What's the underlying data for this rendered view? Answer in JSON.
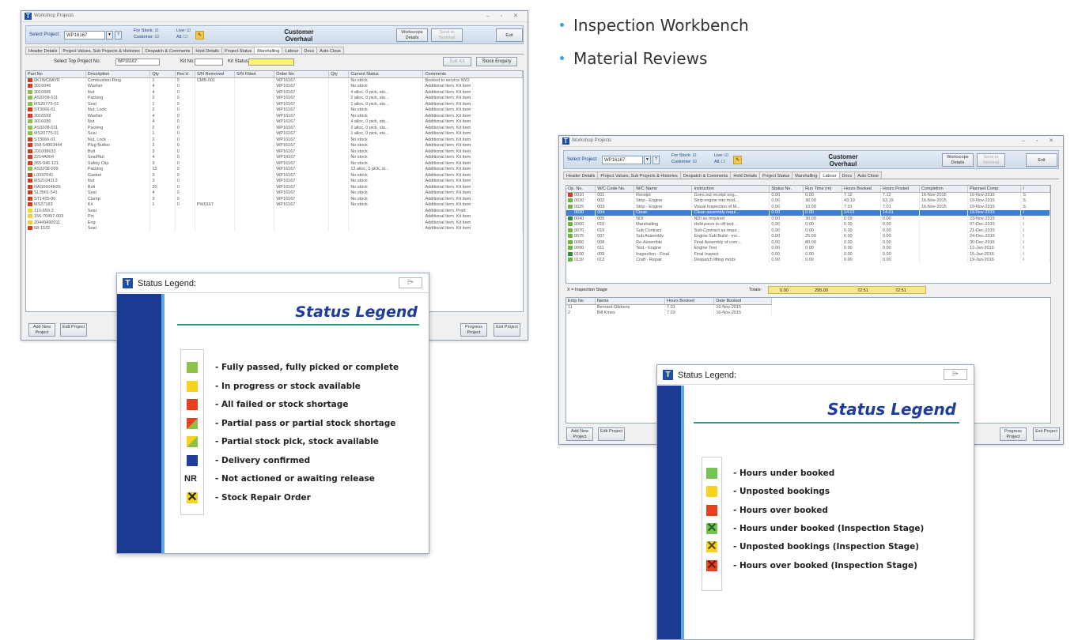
{
  "bullets": [
    "Inspection Workbench",
    "Material Reviews"
  ],
  "left_window": {
    "title": "Workshop Projects",
    "select_label": "Select Project:",
    "project": "WP16167",
    "checks": [
      "For Stock:",
      "Customer:",
      "Live:",
      "All:"
    ],
    "customer": "Customer Overhaul",
    "buttons": [
      "Workscope Details",
      "Send to Nominal",
      "Exit"
    ],
    "tabs": [
      "Header Details",
      "Project Values, Sub Projects & Histories",
      "Despatch & Comments",
      "Hold Details",
      "Project Status",
      "Marshalling",
      "Labour",
      "Docs",
      "Auto Close"
    ],
    "active_tab": "Marshalling",
    "sub_labels": [
      "Select Top Project No:",
      "Kit No:",
      "Kit Status:"
    ],
    "sub_value": "WP16167",
    "sub_buttons": [
      "Edit Kit",
      "Stock Enquiry"
    ],
    "columns": [
      "Part No",
      "Description",
      "Qty",
      "Rec'd",
      "S/N Removed",
      "S/N Fitted",
      "Order No",
      "Qty",
      "Current Status",
      "Comments"
    ],
    "rows": [
      {
        "c": "#d83a20",
        "v": [
          "0K1WC8AYR",
          "Combustion Ring",
          "1",
          "0",
          "CMB-001",
          "",
          "WP16167",
          "",
          "No stock",
          "Booked to service W/O"
        ]
      },
      {
        "c": "#d83a20",
        "v": [
          "3016046",
          "Washer",
          "4",
          "0",
          "",
          "",
          "WP16167",
          "",
          "No stock",
          "Additional Item. Kit item"
        ]
      },
      {
        "c": "#8bc34a",
        "v": [
          "3016686",
          "Nut",
          "4",
          "0",
          "",
          "",
          "WP16167",
          "",
          "4 alloc, 0 pick, sto...",
          "Additional Item. Kit item"
        ]
      },
      {
        "c": "#8bc34a",
        "v": [
          "AS3208-011",
          "Packing",
          "2",
          "0",
          "",
          "",
          "WP16167",
          "",
          "2 alloc, 0 pick, sto...",
          "Additional Item. Kit item"
        ]
      },
      {
        "c": "#8bc34a",
        "v": [
          "MS20775-01",
          "Seal",
          "1",
          "0",
          "",
          "",
          "WP16167",
          "",
          "1 alloc, 0 pick, sto...",
          "Additional Item. Kit item"
        ]
      },
      {
        "c": "#d83a20",
        "v": [
          "ST3066-01",
          "Nut, Lock",
          "2",
          "0",
          "",
          "",
          "WP16167",
          "",
          "No stock",
          "Additional Item. Kit item"
        ]
      },
      {
        "c": "#d83a20",
        "v": [
          "3016598",
          "Washer",
          "4",
          "0",
          "",
          "",
          "WP16167",
          "",
          "No stock",
          "Additional Item. Kit item"
        ]
      },
      {
        "c": "#8bc34a",
        "v": [
          "3016686",
          "Nut",
          "4",
          "0",
          "",
          "",
          "WP16167",
          "",
          "4 alloc, 0 pick, sto...",
          "Additional Item. Kit item"
        ]
      },
      {
        "c": "#8bc34a",
        "v": [
          "AS3208-011",
          "Packing",
          "2",
          "0",
          "",
          "",
          "WP16167",
          "",
          "2 alloc, 0 pick, sto...",
          "Additional Item. Kit item"
        ]
      },
      {
        "c": "#8bc34a",
        "v": [
          "MS20775-01",
          "Seal",
          "1",
          "0",
          "",
          "",
          "WP16167",
          "",
          "1 alloc, 0 pick, sto...",
          "Additional Item. Kit item"
        ]
      },
      {
        "c": "#d83a20",
        "v": [
          "ST3066-01",
          "Nut, Lock",
          "2",
          "0",
          "",
          "",
          "WP16167",
          "",
          "No stock",
          "Additional Item. Kit item"
        ]
      },
      {
        "c": "#d83a20",
        "v": [
          "158-54803444",
          "Plug Button",
          "3",
          "0",
          "",
          "",
          "WP16167",
          "",
          "No stock",
          "Additional Item. Kit item"
        ]
      },
      {
        "c": "#d83a20",
        "v": [
          "201008633",
          "Bolt",
          "3",
          "0",
          "",
          "",
          "WP16167",
          "",
          "No stock",
          "Additional Item. Kit item"
        ]
      },
      {
        "c": "#d83a20",
        "v": [
          "2214A004",
          "Seal/Nut",
          "4",
          "0",
          "",
          "",
          "WP16167",
          "",
          "No stock",
          "Additional Item. Kit item"
        ]
      },
      {
        "c": "#d83a20",
        "v": [
          "355-946-121",
          "Safety Clip",
          "3",
          "0",
          "",
          "",
          "WP16167",
          "",
          "No stock",
          "Additional Item. Kit item"
        ]
      },
      {
        "c": "#8bc34a",
        "v": [
          "AS3208-009",
          "Packing",
          "13",
          "0",
          "",
          "",
          "WP16167",
          "",
          "13 alloc, 0 pick, st...",
          "Additional Item. Kit item"
        ]
      },
      {
        "c": "#d83a20",
        "v": [
          "L0337041",
          "Gasket",
          "3",
          "0",
          "",
          "",
          "WP16167",
          "",
          "No stock",
          "Additional Item. Kit item"
        ]
      },
      {
        "c": "#d83a20",
        "v": [
          "MS21042L3",
          "Nut",
          "3",
          "0",
          "",
          "",
          "WP16167",
          "",
          "No stock",
          "Additional Item. Kit item"
        ]
      },
      {
        "c": "#d83a20",
        "v": [
          "NAS6604H26",
          "Bolt",
          "20",
          "0",
          "",
          "",
          "WP16167",
          "",
          "No stock",
          "Additional Item. Kit item"
        ]
      },
      {
        "c": "#d83a20",
        "v": [
          "SL3561-541",
          "Seal",
          "4",
          "0",
          "",
          "",
          "WP16167",
          "",
          "No stock",
          "Additional Item. Kit item"
        ]
      },
      {
        "c": "#d83a20",
        "v": [
          "ST1425-00",
          "Clamp",
          "3",
          "0",
          "",
          "",
          "WP16167",
          "",
          "No stock",
          "Additional Item. Kit item"
        ]
      },
      {
        "c": "#d83a20",
        "v": [
          "MS27183",
          "Kit",
          "1",
          "0",
          "PW0167",
          "",
          "WP16167",
          "",
          "No stock",
          "Additional Item. Kit item"
        ]
      },
      {
        "c": "#f2d22e",
        "v": [
          "110-659-3",
          "Seal",
          "",
          "",
          "",
          "",
          "",
          "",
          "",
          "Additional Item. Pratt"
        ]
      },
      {
        "c": "#f2d22e",
        "v": [
          "156-70497-003",
          "Pin",
          "",
          "",
          "",
          "",
          "",
          "",
          "",
          "Additional Item. Kit item"
        ]
      },
      {
        "c": "#f2d22e",
        "v": [
          "20449490011",
          "Eng",
          "",
          "",
          "",
          "",
          "",
          "",
          "",
          "Additional Item. Kit item"
        ]
      },
      {
        "c": "#d83a20",
        "v": [
          "68-1532",
          "Seal",
          "",
          "",
          "",
          "",
          "",
          "",
          "",
          "Additional Item. Kit item"
        ]
      }
    ],
    "bottom_buttons": [
      "Add New Project",
      "Edit Project",
      "Progress Project",
      "Exit Project"
    ]
  },
  "right_window": {
    "title": "Workshop Projects",
    "select_label": "Select Project:",
    "project": "WP16167",
    "checks": [
      "For Stock:",
      "Customer:",
      "Live:",
      "All:"
    ],
    "customer": "Customer Overhaul",
    "buttons": [
      "Workscope Details",
      "Send to Nominal",
      "Exit"
    ],
    "tabs": [
      "Header Details",
      "Project Values, Sub Projects & Histories",
      "Despatch & Comments",
      "Hold Details",
      "Project Status",
      "Marshalling",
      "Labour",
      "Docs",
      "Auto Close"
    ],
    "active_tab": "Labour",
    "columns": [
      "Op. No.",
      "W/C Code No.",
      "W/C Name",
      "Instruction",
      "Status No.",
      "Run Time (m)",
      "Hours Booked",
      "Hours Posted",
      "Completion",
      "Planned Comp.",
      "I"
    ],
    "rows": [
      {
        "c": "#d83a20",
        "v": [
          "0010",
          "001",
          "Receipt",
          "Goes out receipt eng...",
          "0.00",
          "0.00",
          "7.12",
          "7.12",
          "16-Nov-2015",
          "16-Nov-2015",
          "S"
        ]
      },
      {
        "c": "#69b83a",
        "v": [
          "0020",
          "002",
          "Strip - Engine",
          "Strip engine into mod...",
          "0.00",
          "30.00",
          "43.19",
          "63.19",
          "16-Nov-2015",
          "19-Nov-2015",
          "S"
        ]
      },
      {
        "c": "#69b83a",
        "v": [
          "0025",
          "003",
          "Strip - Engine",
          "Visual Inspection of M...",
          "0.00",
          "10.00",
          "7.01",
          "7.01",
          "16-Nov-2015",
          "19-Nov-2015",
          "S"
        ]
      },
      {
        "c": "#3d7fd6",
        "s": true,
        "v": [
          "0030",
          "004",
          "Clean",
          "Clean assembly requi...",
          "0.00",
          "0.00",
          "14.01",
          "14.01",
          "",
          "19-Nov-2015",
          "I"
        ]
      },
      {
        "c": "#2e8b3a",
        "v": [
          "0040",
          "005",
          "NDI",
          "NDI as required",
          "0.00",
          "30.00",
          "0.09",
          "0.00",
          "",
          "23-Nov-2015",
          "I"
        ]
      },
      {
        "c": "#69b83a",
        "v": [
          "0060",
          "010",
          "Marshalling",
          "Hold piece to off tool ...",
          "0.00",
          "0.00",
          "0.00",
          "0.00",
          "",
          "07-Dec-2015",
          "I"
        ]
      },
      {
        "c": "#69b83a",
        "v": [
          "0070",
          "015",
          "Sub Contract",
          "Sub-Contract as requi...",
          "0.00",
          "0.00",
          "0.00",
          "0.00",
          "",
          "21-Dec-2015",
          "I"
        ]
      },
      {
        "c": "#69b83a",
        "v": [
          "0075",
          "007",
          "Sub Assembly",
          "Engine Sub Build - mo...",
          "0.00",
          "25.00",
          "0.00",
          "0.00",
          "",
          "24-Dec-2015",
          "I"
        ]
      },
      {
        "c": "#69b83a",
        "v": [
          "0080",
          "008",
          "Re-Assemble",
          "Final Assembly of com...",
          "0.00",
          "80.00",
          "0.00",
          "0.00",
          "",
          "30-Dec-2015",
          "I"
        ]
      },
      {
        "c": "#69b83a",
        "v": [
          "0090",
          "011",
          "Test - Engine",
          "Engine Test",
          "0.00",
          "0.00",
          "0.00",
          "0.00",
          "",
          "12-Jan-2016",
          "I"
        ]
      },
      {
        "c": "#2e8b3a",
        "v": [
          "0100",
          "009",
          "Inspection - Final",
          "Final Inspect",
          "0.00",
          "0.00",
          "0.00",
          "0.00",
          "",
          "15-Jan-2016",
          "I"
        ]
      },
      {
        "c": "#69b83a",
        "v": [
          "0110",
          "012",
          "Craft - Repair",
          "Despatch lifting mods",
          "0.00",
          "0.00",
          "0.00",
          "0.00",
          "",
          "19-Jan-2016",
          "I"
        ]
      }
    ],
    "inspection_label": "X = Inspection Stage",
    "totals_label": "Totals:",
    "totals": [
      "0.00",
      "295.00",
      "72:51",
      "72:51"
    ],
    "booking_columns": [
      "Emp No",
      "Name",
      "Hours Booked",
      "Date Booked"
    ],
    "booking_rows": [
      [
        "11",
        "Bernard Gibbons",
        "7.01",
        "16-Nov-2015"
      ],
      [
        "2",
        "Bill Kmes",
        "7.03",
        "16-Nov-2015"
      ]
    ],
    "bottom_buttons": [
      "Add New Project",
      "Edit Project",
      "Progress Project",
      "Exit Project"
    ]
  },
  "legend_left": {
    "title": "Status Legend:",
    "close": "⌲",
    "header": "Status Legend",
    "items": [
      {
        "sym": "square",
        "color": "#8bc34a",
        "label": "Fully passed, fully picked or complete"
      },
      {
        "sym": "square",
        "color": "#f5d31f",
        "label": "In progress or stock available"
      },
      {
        "sym": "square",
        "color": "#e8411f",
        "label": "All failed or stock shortage"
      },
      {
        "sym": "diag",
        "color": "#e8411f",
        "color2": "#8bc34a",
        "label": "Partial pass or partial stock shortage"
      },
      {
        "sym": "diag",
        "color": "#f5d31f",
        "color2": "#8bc34a",
        "label": "Partial stock pick, stock available"
      },
      {
        "sym": "square",
        "color": "#1f3d99",
        "label": "Delivery confirmed"
      },
      {
        "sym": "text",
        "text": "NR",
        "label": "Not actioned or awaiting release"
      },
      {
        "sym": "x",
        "color": "#f5d31f",
        "xcolor": "#222222",
        "label": "Stock Repair Order"
      }
    ]
  },
  "legend_right": {
    "title": "Status Legend:",
    "close": "⌲",
    "header": "Status Legend",
    "items": [
      {
        "sym": "square",
        "color": "#78c452",
        "label": "Hours under booked"
      },
      {
        "sym": "square",
        "color": "#f5d31f",
        "label": "Unposted bookings"
      },
      {
        "sym": "square",
        "color": "#e8411f",
        "label": "Hours over booked"
      },
      {
        "sym": "x",
        "color": "#78c452",
        "xcolor": "#1d5e1d",
        "label": "Hours under booked (Inspection Stage)"
      },
      {
        "sym": "x",
        "color": "#f5d31f",
        "xcolor": "#5a4a00",
        "label": "Unposted bookings (Inspection Stage)"
      },
      {
        "sym": "x",
        "color": "#e8411f",
        "xcolor": "#6b1a0a",
        "label": "Hours over booked (Inspection Stage)"
      }
    ]
  }
}
